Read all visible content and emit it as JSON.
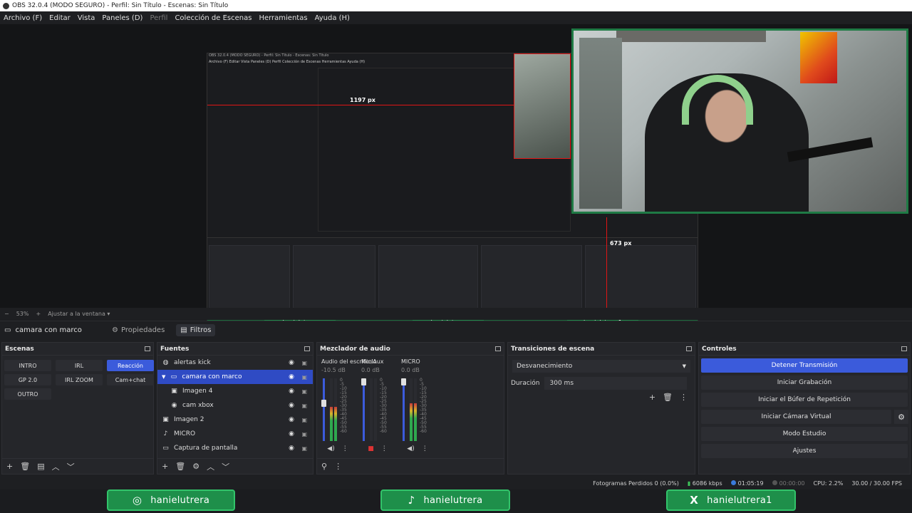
{
  "window": {
    "title": "OBS 32.0.4 (MODO SEGURO) - Perfil: Sin Título - Escenas: Sin Título"
  },
  "menu": [
    {
      "label": "Archivo (F)",
      "dim": false
    },
    {
      "label": "Editar",
      "dim": false
    },
    {
      "label": "Vista",
      "dim": false
    },
    {
      "label": "Paneles (D)",
      "dim": false
    },
    {
      "label": "Perfil",
      "dim": true
    },
    {
      "label": "Colección de Escenas",
      "dim": false
    },
    {
      "label": "Herramientas",
      "dim": false
    },
    {
      "label": "Ayuda (H)",
      "dim": false
    }
  ],
  "preview": {
    "px_label_1": "1197 px",
    "px_label_2": "673 px",
    "nested_title": "OBS 32.0.4 (MODO SEGURO) - Perfil: Sin Título - Escenas: Sin Título",
    "nested_menu": "Archivo (F)   Editar   Vista   Paneles (D)   Perfil   Colección de Escenas   Herramientas   Ayuda (H)"
  },
  "zoom": {
    "minus": "−",
    "value": "53%",
    "plus": "+",
    "fit": "Ajustar a la ventana"
  },
  "context": {
    "source": "camara con marco",
    "properties": "Propiedades",
    "filters": "Filtros"
  },
  "scenes": {
    "title": "Escenas",
    "items": [
      {
        "label": "INTRO",
        "active": false
      },
      {
        "label": "IRL",
        "active": false
      },
      {
        "label": "Reacción",
        "active": true
      },
      {
        "label": "GP 2.0",
        "active": false
      },
      {
        "label": "IRL ZOOM",
        "active": false
      },
      {
        "label": "Cam+chat",
        "active": false
      },
      {
        "label": "OUTRO",
        "active": false
      }
    ]
  },
  "sources": {
    "title": "Fuentes",
    "items": [
      {
        "label": "alertas kick",
        "icon": "globe-icon",
        "glyph": "◍",
        "indent": 0,
        "selected": false
      },
      {
        "label": "camara con marco",
        "icon": "folder-icon",
        "glyph": "▭",
        "indent": 0,
        "selected": true,
        "expand": "▼"
      },
      {
        "label": "Imagen 4",
        "icon": "image-icon",
        "glyph": "▣",
        "indent": 1,
        "selected": false
      },
      {
        "label": "cam xbox",
        "icon": "camera-icon",
        "glyph": "◉",
        "indent": 1,
        "selected": false
      },
      {
        "label": "Imagen 2",
        "icon": "image-icon",
        "glyph": "▣",
        "indent": 0,
        "selected": false
      },
      {
        "label": "MICRO",
        "icon": "mic-icon",
        "glyph": "♪",
        "indent": 0,
        "selected": false
      },
      {
        "label": "Captura de pantalla",
        "icon": "monitor-icon",
        "glyph": "▭",
        "indent": 0,
        "selected": false
      }
    ]
  },
  "mixer": {
    "title": "Mezclador de audio",
    "ticks": [
      "0",
      "-5",
      "-10",
      "-15",
      "-20",
      "-25",
      "-30",
      "-35",
      "-40",
      "-45",
      "-50",
      "-55",
      "-60"
    ],
    "channels": [
      {
        "name": "Audio del escritorio",
        "db": "-10.5 dB",
        "level": 0.55,
        "muted": false
      },
      {
        "name": "Mic/Aux",
        "db": "0.0 dB",
        "level": 0.0,
        "muted": true
      },
      {
        "name": "MICRO",
        "db": "0.0 dB",
        "level": 0.6,
        "muted": false
      }
    ]
  },
  "transitions": {
    "title": "Transiciones de escena",
    "selected": "Desvanecimiento",
    "duration_label": "Duración",
    "duration_value": "300 ms"
  },
  "controls": {
    "title": "Controles",
    "buttons": [
      {
        "label": "Detener Transmisión",
        "blue": true
      },
      {
        "label": "Iniciar Grabación",
        "blue": false
      },
      {
        "label": "Iniciar el Búfer de Repetición",
        "blue": false
      },
      {
        "label": "Iniciar Cámara Virtual",
        "blue": false,
        "gear": true
      },
      {
        "label": "Modo Estudio",
        "blue": false
      },
      {
        "label": "Ajustes",
        "blue": false
      }
    ]
  },
  "status": {
    "dropped": "Fotogramas Perdidos 0 (0.0%)",
    "bitrate": "6086 kbps",
    "stream_time": "01:05:19",
    "rec_time": "00:00:00",
    "cpu": "CPU: 2.2%",
    "fps": "30.00 / 30.00 FPS"
  },
  "socials": [
    {
      "handle": "hanielutrera",
      "icon": "instagram-icon",
      "glyph": "◎"
    },
    {
      "handle": "hanielutrera",
      "icon": "tiktok-icon",
      "glyph": "♪"
    },
    {
      "handle": "hanielutrera1",
      "icon": "x-icon",
      "glyph": "X"
    }
  ],
  "colors": {
    "accent": "#3b5bdb",
    "green": "#1e8f4a",
    "red": "#e01515"
  }
}
